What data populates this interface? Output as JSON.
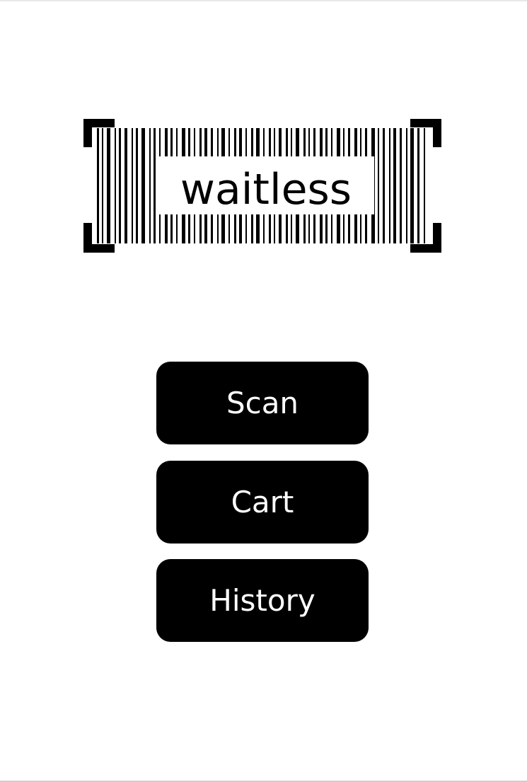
{
  "logo": {
    "wordmark": "waitless",
    "icon": "barcode-scanner-frame-icon"
  },
  "menu": {
    "buttons": [
      {
        "label": "Scan"
      },
      {
        "label": "Cart"
      },
      {
        "label": "History"
      }
    ]
  },
  "colors": {
    "background": "#ffffff",
    "button_background": "#000000",
    "button_text": "#ffffff",
    "logo": "#000000"
  }
}
